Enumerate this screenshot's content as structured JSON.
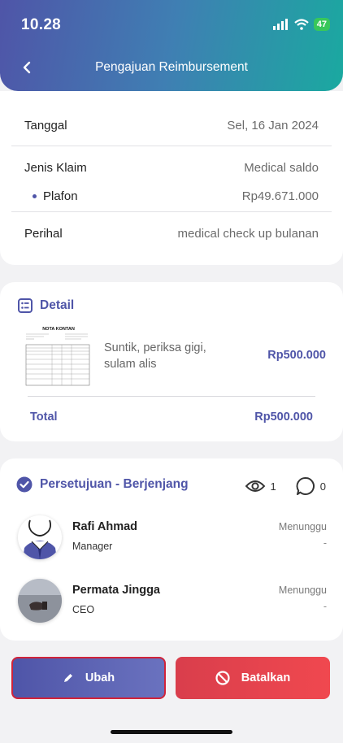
{
  "status_bar": {
    "time": "10.28",
    "battery": "47"
  },
  "header": {
    "title": "Pengajuan Reimbursement"
  },
  "info": {
    "tanggal_label": "Tanggal",
    "tanggal_value": "Sel, 16 Jan 2024",
    "jenis_label": "Jenis Klaim",
    "jenis_value": "Medical saldo",
    "plafon_label": "Plafon",
    "plafon_value": "Rp49.671.000",
    "perihal_label": "Perihal",
    "perihal_value": "medical check up bulanan"
  },
  "detail": {
    "title": "Detail",
    "receipt_heading": "NOTA KONTAN",
    "description": "Suntik, periksa gigi, sulam alis",
    "amount": "Rp500.000",
    "total_label": "Total",
    "total_amount": "Rp500.000"
  },
  "approval": {
    "title": "Persetujuan - Berjenjang",
    "views": "1",
    "comments": "0",
    "approvers": [
      {
        "name": "Rafi Ahmad",
        "role": "Manager",
        "status": "Menunggu",
        "note": "-"
      },
      {
        "name": "Permata Jingga",
        "role": "CEO",
        "status": "Menunggu",
        "note": "-"
      }
    ]
  },
  "actions": {
    "edit_label": "Ubah",
    "cancel_label": "Batalkan"
  },
  "colors": {
    "primary": "#4f55a8",
    "accent": "#1aa9a0",
    "danger": "#e3444d"
  }
}
